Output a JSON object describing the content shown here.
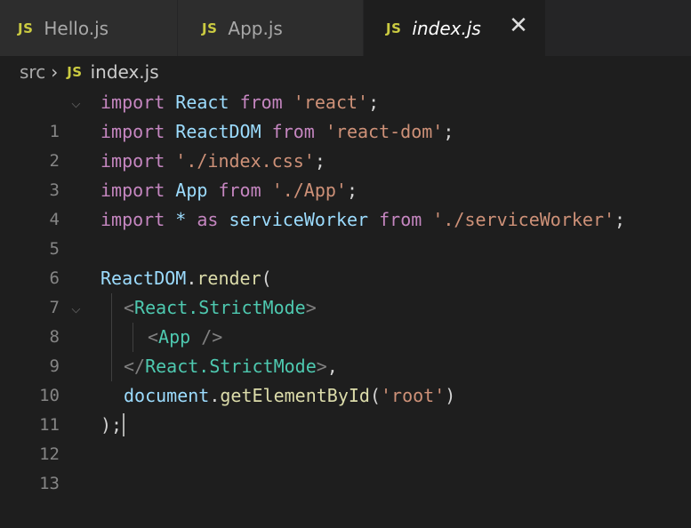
{
  "tabs": [
    {
      "icon": "JS",
      "label": "Hello.js"
    },
    {
      "icon": "JS",
      "label": "App.js"
    },
    {
      "icon": "JS",
      "label": "index.js",
      "close": "✕"
    }
  ],
  "breadcrumb": {
    "folder": "src",
    "separator": "›",
    "icon": "JS",
    "file": "index.js"
  },
  "editor": {
    "lines": [
      {
        "n": "1"
      },
      {
        "n": "2"
      },
      {
        "n": "3"
      },
      {
        "n": "4"
      },
      {
        "n": "5"
      },
      {
        "n": "6"
      },
      {
        "n": "7"
      },
      {
        "n": "8"
      },
      {
        "n": "9"
      },
      {
        "n": "10"
      },
      {
        "n": "11"
      },
      {
        "n": "12"
      },
      {
        "n": "13"
      }
    ],
    "tokens": {
      "import": "import",
      "from": "from",
      "as": "as",
      "star": "*",
      "React": "React",
      "ReactDOM": "ReactDOM",
      "App": "App",
      "serviceWorker": "serviceWorker",
      "s_react": "'react'",
      "s_react_dom": "'react-dom'",
      "s_index_css": "'./index.css'",
      "s_app": "'./App'",
      "s_sw": "'./serviceWorker'",
      "semi": ";",
      "render_obj": "ReactDOM",
      "dot": ".",
      "render": "render",
      "paren_open": "(",
      "lt": "<",
      "gt": ">",
      "lt_slash": "</",
      "self_close": " />",
      "strict": "React.StrictMode",
      "app_tag": "App",
      "comma": ",",
      "document": "document",
      "getById": "getElementById",
      "s_root": "'root'",
      "paren_close": ")",
      "close_semi": ");"
    },
    "colors": {
      "keyword": "#c586c0",
      "identifier": "#9cdcfe",
      "string": "#ce9178",
      "function": "#dcdcaa",
      "tag": "#4ec9b0"
    }
  }
}
